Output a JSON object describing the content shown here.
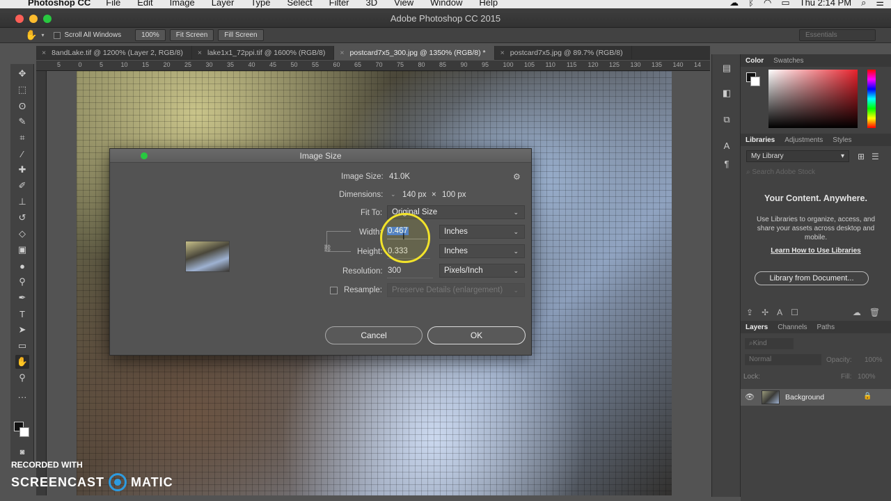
{
  "menubar": {
    "app_name": "Photoshop CC",
    "items": [
      "File",
      "Edit",
      "Image",
      "Layer",
      "Type",
      "Select",
      "Filter",
      "3D",
      "View",
      "Window",
      "Help"
    ],
    "clock": "Thu 2:14 PM"
  },
  "window": {
    "title": "Adobe Photoshop CC 2015"
  },
  "options_bar": {
    "scroll_all_windows": "Scroll All Windows",
    "zoom_100": "100%",
    "fit_screen": "Fit Screen",
    "fill_screen": "Fill Screen",
    "workspace": "Essentials"
  },
  "tabs": [
    {
      "label": "8andLake.tif @ 1200% (Layer 2, RGB/8)"
    },
    {
      "label": "lake1x1_72ppi.tif @ 1600% (RGB/8)"
    },
    {
      "label": "postcard7x5_300.jpg @ 1350% (RGB/8) *"
    },
    {
      "label": "postcard7x5.jpg @ 89.7% (RGB/8)"
    }
  ],
  "ruler_ticks": [
    "5",
    "0",
    "5",
    "10",
    "15",
    "20",
    "25",
    "30",
    "35",
    "40",
    "45",
    "50",
    "55",
    "60",
    "65",
    "70",
    "75",
    "80",
    "85",
    "90",
    "95",
    "100",
    "105",
    "110",
    "115",
    "120",
    "125",
    "130",
    "135",
    "140",
    "14"
  ],
  "dialog": {
    "title": "Image Size",
    "image_size_label": "Image Size:",
    "image_size_value": "41.0K",
    "dimensions_label": "Dimensions:",
    "dimensions_w": "140 px",
    "dimensions_x": "×",
    "dimensions_h": "100 px",
    "fit_to_label": "Fit To:",
    "fit_to_value": "Original Size",
    "width_label": "Width:",
    "width_value": "0.467",
    "width_unit": "Inches",
    "height_label": "Height:",
    "height_value": "0.333",
    "height_unit": "Inches",
    "resolution_label": "Resolution:",
    "resolution_value": "300",
    "resolution_unit": "Pixels/Inch",
    "resample_label": "Resample:",
    "resample_value": "Preserve Details (enlargement)",
    "cancel": "Cancel",
    "ok": "OK"
  },
  "panels": {
    "color_tabs": [
      "Color",
      "Swatches"
    ],
    "library_tabs": [
      "Libraries",
      "Adjustments",
      "Styles"
    ],
    "library_select": "My Library",
    "library_search_placeholder": "Search Adobe Stock",
    "lib_heading": "Your Content. Anywhere.",
    "lib_text": "Use Libraries to organize, access, and share your assets across desktop and mobile.",
    "lib_link": "Learn How to Use Libraries",
    "lib_button": "Library from Document...",
    "layers_tabs": [
      "Layers",
      "Channels",
      "Paths"
    ],
    "kind_filter": "Kind",
    "blend_mode": "Normal",
    "opacity_label": "Opacity:",
    "opacity_value": "100%",
    "lock_label": "Lock:",
    "fill_label": "Fill:",
    "fill_value": "100%",
    "layer_name": "Background"
  },
  "watermark": {
    "line1": "RECORDED WITH",
    "line2a": "SCREENCAST",
    "line2b": "MATIC"
  },
  "colors": {
    "foreground": "#111111",
    "background": "#ffffff",
    "accent_picker": "#e8222c"
  }
}
